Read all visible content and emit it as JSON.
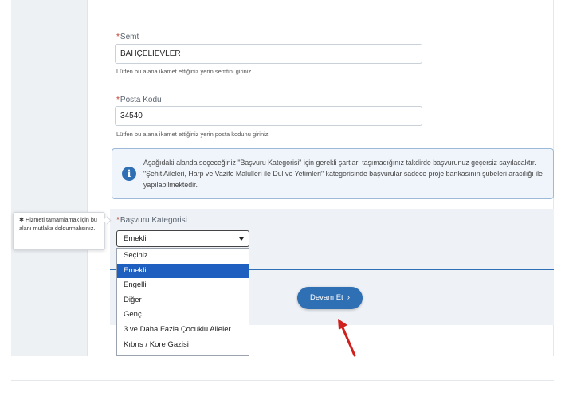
{
  "fields": {
    "semt": {
      "required_mark": "*",
      "label": "Semt",
      "value": "BAHÇELİEVLER",
      "help": "Lütfen bu alana ikamet ettiğiniz yerin semtini giriniz."
    },
    "posta_kodu": {
      "required_mark": "*",
      "label": "Posta Kodu",
      "value": "34540",
      "help": "Lütfen bu alana ikamet ettiğiniz yerin posta kodunu giriniz."
    }
  },
  "info": {
    "icon": "info-icon",
    "glyph": "i",
    "text": "Aşağıdaki alanda seçeceğiniz \"Başvuru Kategorisi\" için gerekli şartları taşımadığınız takdirde başvurunuz geçersiz sayılacaktır. \"Şehit Aileleri, Harp ve Vazife Malulleri ile Dul ve Yetimleri\" kategorisinde başvurular sadece proje bankasının şubeleri aracılığı ile yapılabilmektedir."
  },
  "tooltip": {
    "text": "✱ Hizmeti tamamlamak için bu alanı mutlaka doldurmalısınız."
  },
  "category": {
    "required_mark": "*",
    "label": "Başvuru Kategorisi",
    "selected": "Emekli",
    "options": [
      "Seçiniz",
      "Emekli",
      "Engelli",
      "Diğer",
      "Genç",
      "3 ve Daha Fazla Çocuklu Aileler",
      "Kıbrıs / Kore Gazisi"
    ],
    "highlighted_index": 1
  },
  "actions": {
    "next_label": "Devam Et",
    "next_chevron": "›"
  },
  "colors": {
    "primary": "#2f6fb3",
    "highlight": "#1f5fbf",
    "annotation_arrow": "#d0201d"
  }
}
